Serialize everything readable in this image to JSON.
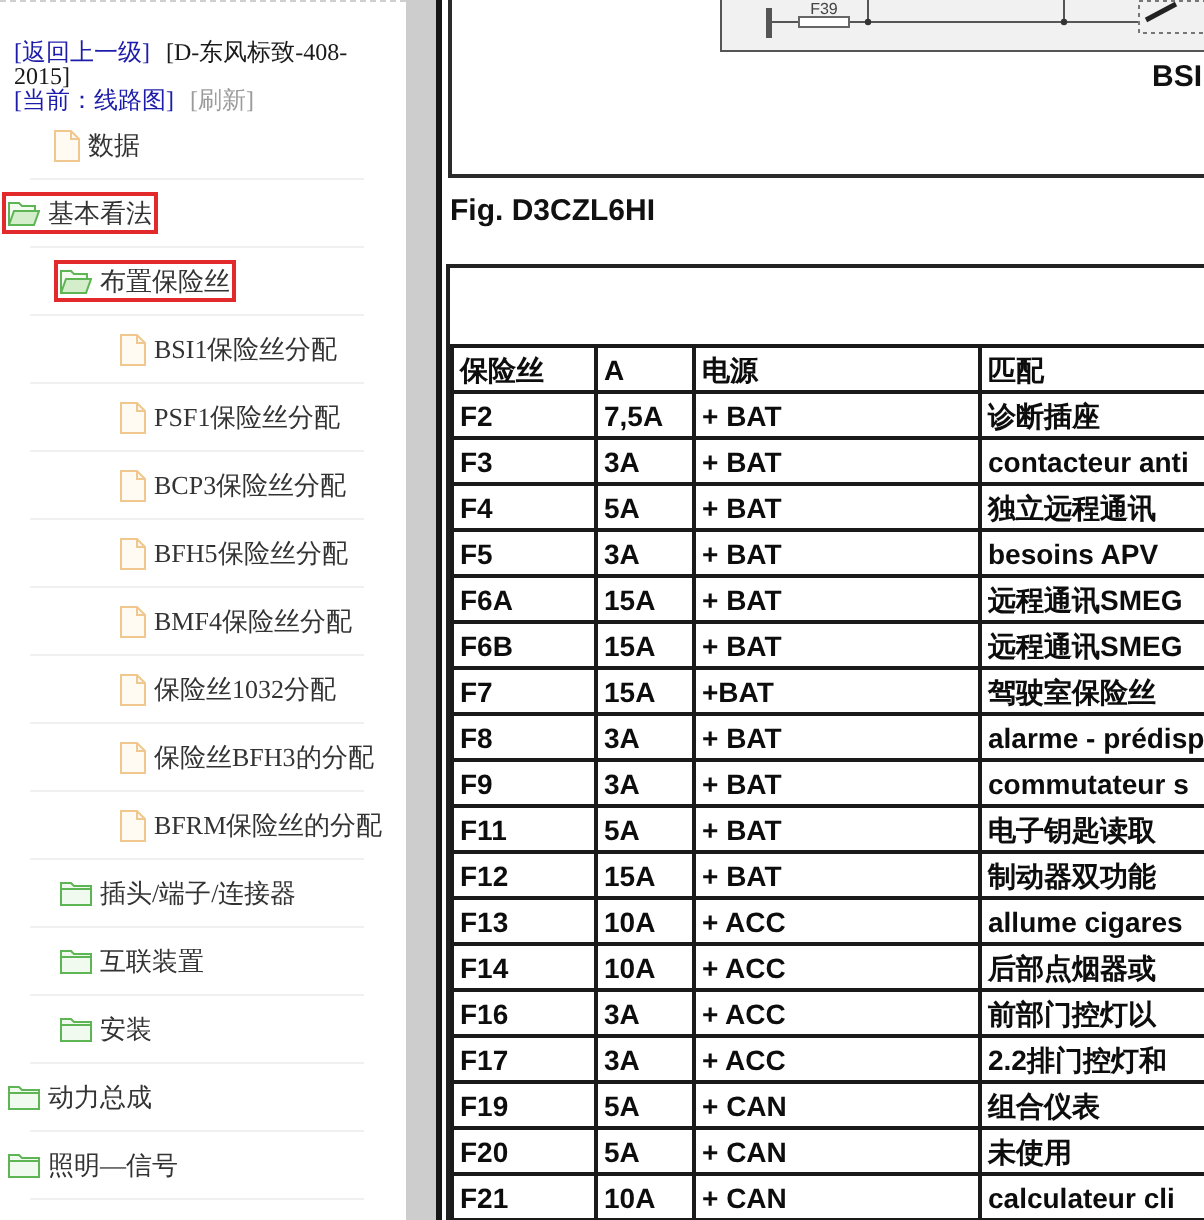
{
  "sidebar": {
    "nav_lines": [
      [
        {
          "kind": "link",
          "text": "[返回上一级]"
        },
        {
          "kind": "label",
          "text": "[D-东风标致-408-2015]"
        }
      ],
      [
        {
          "kind": "link",
          "text": "[当前：线路图]"
        },
        {
          "kind": "muted_link",
          "text": "[刷新]"
        }
      ]
    ],
    "tree": [
      {
        "kind": "file",
        "label": "数据",
        "selected": false
      },
      {
        "kind": "folder",
        "label": "基本看法",
        "selected": true,
        "expanded": true,
        "children": [
          {
            "kind": "folder",
            "label": "布置保险丝",
            "selected": true,
            "expanded": true,
            "children": [
              {
                "kind": "file",
                "label": "BSI1保险丝分配",
                "selected": false
              },
              {
                "kind": "file",
                "label": "PSF1保险丝分配",
                "selected": false
              },
              {
                "kind": "file",
                "label": "BCP3保险丝分配",
                "selected": false
              },
              {
                "kind": "file",
                "label": "BFH5保险丝分配",
                "selected": false
              },
              {
                "kind": "file",
                "label": "BMF4保险丝分配",
                "selected": false
              },
              {
                "kind": "file",
                "label": "保险丝1032分配",
                "selected": false
              },
              {
                "kind": "file",
                "label": "保险丝BFH3的分配",
                "selected": false
              },
              {
                "kind": "file",
                "label": "BFRM保险丝的分配",
                "selected": false
              }
            ]
          },
          {
            "kind": "folder",
            "label": "插头/端子/连接器",
            "selected": false,
            "expanded": false
          },
          {
            "kind": "folder",
            "label": "互联装置",
            "selected": false,
            "expanded": false
          },
          {
            "kind": "folder",
            "label": "安装",
            "selected": false,
            "expanded": false
          }
        ]
      },
      {
        "kind": "folder",
        "label": "动力总成",
        "selected": false,
        "expanded": false
      },
      {
        "kind": "folder",
        "label": "照明—信号",
        "selected": false,
        "expanded": false
      }
    ]
  },
  "document": {
    "diagram": {
      "fuse_label": "F39",
      "module_label": "BSI"
    },
    "figure_caption": "Fig. D3CZL6HI",
    "table": {
      "columns": [
        "保险丝",
        "A",
        "电源",
        "匹配"
      ],
      "rows": [
        [
          "F2",
          "7,5A",
          "+ BAT",
          "诊断插座"
        ],
        [
          "F3",
          "3A",
          "+ BAT",
          "contacteur anti"
        ],
        [
          "F4",
          "5A",
          "+ BAT",
          "独立远程通讯"
        ],
        [
          "F5",
          "3A",
          "+ BAT",
          "besoins APV"
        ],
        [
          "F6A",
          "15A",
          "+ BAT",
          "远程通讯SMEG"
        ],
        [
          "F6B",
          "15A",
          "+ BAT",
          "远程通讯SMEG"
        ],
        [
          "F7",
          "15A",
          "+BAT",
          "驾驶室保险丝"
        ],
        [
          "F8",
          "3A",
          "+ BAT",
          "alarme - prédisp"
        ],
        [
          "F9",
          "3A",
          "+ BAT",
          "commutateur s"
        ],
        [
          "F11",
          "5A",
          "+ BAT",
          "电子钥匙读取"
        ],
        [
          "F12",
          "15A",
          "+ BAT",
          "制动器双功能"
        ],
        [
          "F13",
          "10A",
          "+ ACC",
          "allume cigares"
        ],
        [
          "F14",
          "10A",
          "+ ACC",
          "后部点烟器或"
        ],
        [
          "F16",
          "3A",
          "+ ACC",
          "前部门控灯以"
        ],
        [
          "F17",
          "3A",
          "+ ACC",
          "2.2排门控灯和"
        ],
        [
          "F19",
          "5A",
          "+ CAN",
          "组合仪表"
        ],
        [
          "F20",
          "5A",
          "+ CAN",
          "未使用"
        ],
        [
          "F21",
          "10A",
          "+ CAN",
          "calculateur cli"
        ]
      ]
    }
  }
}
